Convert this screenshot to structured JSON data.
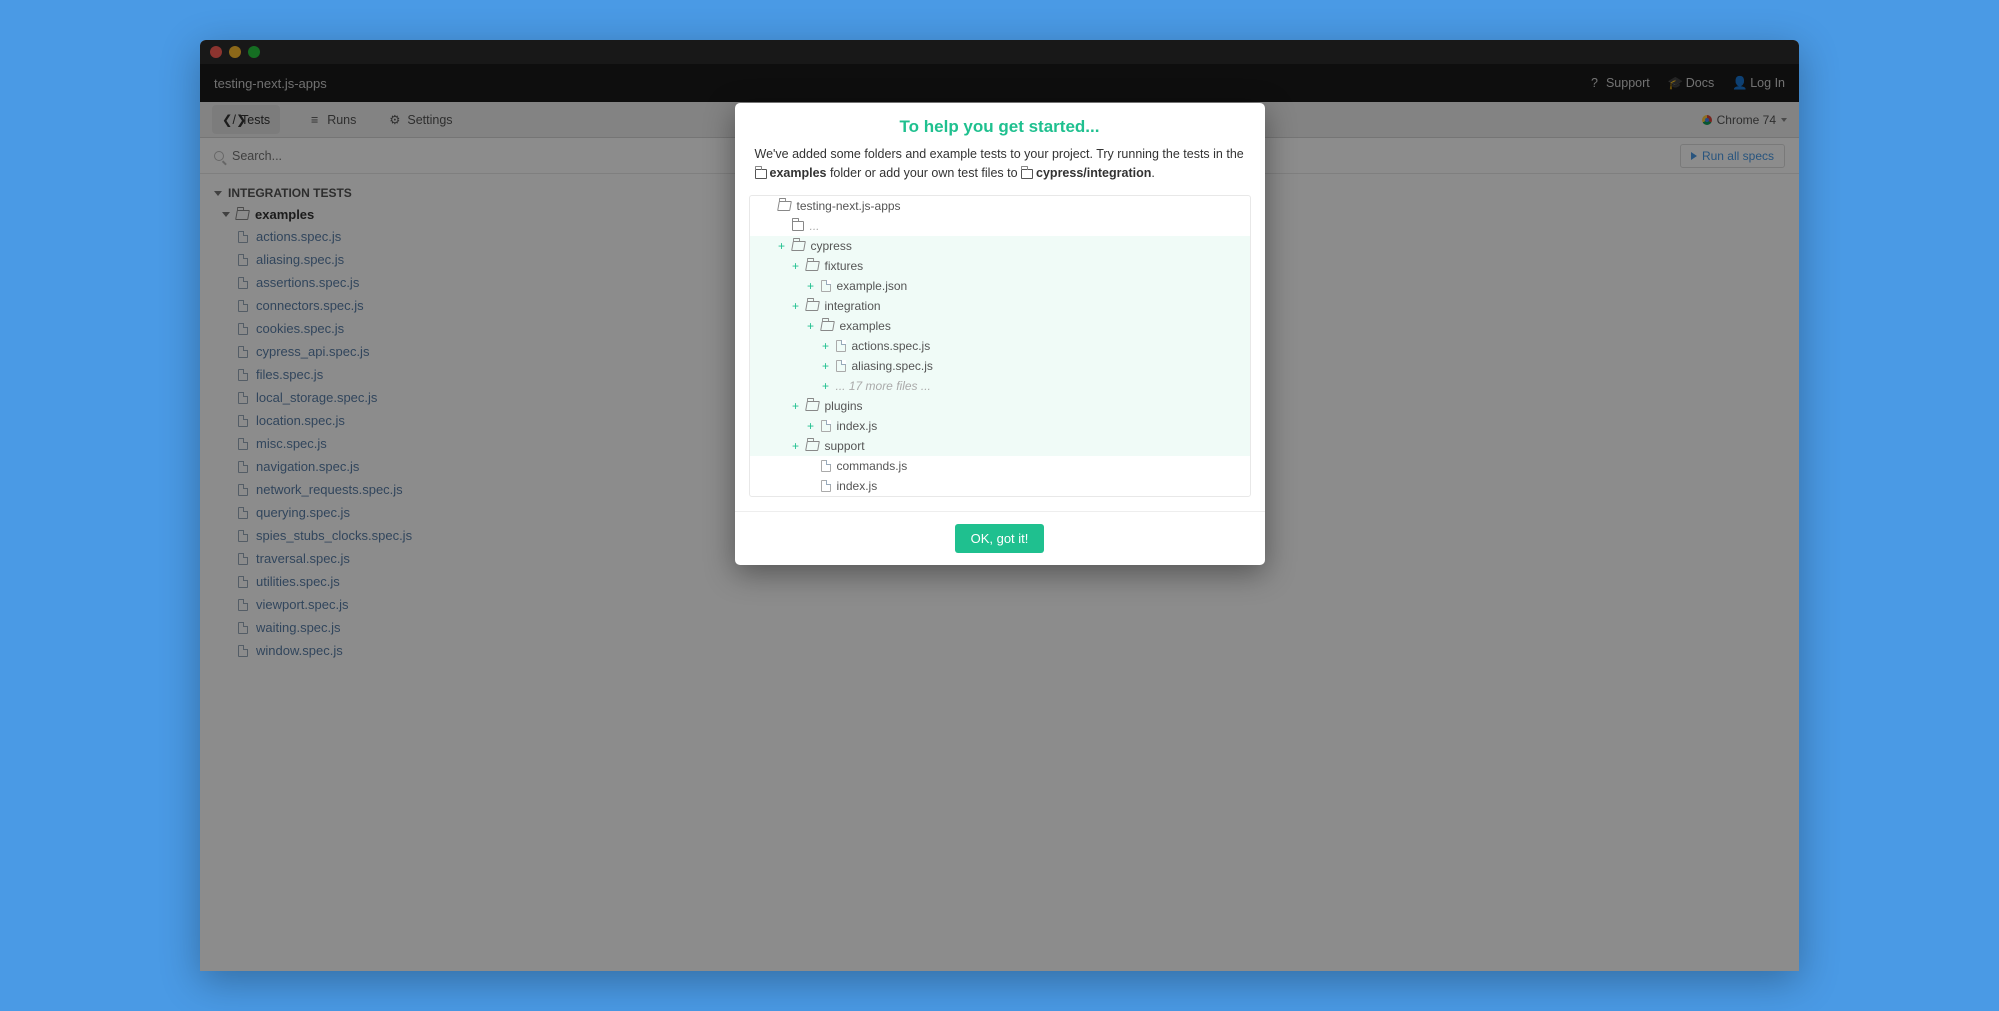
{
  "header": {
    "project_name": "testing-next.js-apps",
    "support": "Support",
    "docs": "Docs",
    "login": "Log In"
  },
  "tabs": {
    "tests": "Tests",
    "runs": "Runs",
    "settings": "Settings",
    "browser": "Chrome 74"
  },
  "search": {
    "placeholder": "Search...",
    "run_all": "Run all specs"
  },
  "sidebar": {
    "section": "INTEGRATION TESTS",
    "folder": "examples",
    "specs": [
      "actions.spec.js",
      "aliasing.spec.js",
      "assertions.spec.js",
      "connectors.spec.js",
      "cookies.spec.js",
      "cypress_api.spec.js",
      "files.spec.js",
      "local_storage.spec.js",
      "location.spec.js",
      "misc.spec.js",
      "navigation.spec.js",
      "network_requests.spec.js",
      "querying.spec.js",
      "spies_stubs_clocks.spec.js",
      "traversal.spec.js",
      "utilities.spec.js",
      "viewport.spec.js",
      "waiting.spec.js",
      "window.spec.js"
    ]
  },
  "modal": {
    "title": "To help you get started...",
    "text_pre": "We've added some folders and example tests to your project. Try running the tests in the ",
    "text_examples": "examples",
    "text_mid": " folder or add your own test files to ",
    "text_integration": "cypress/integration",
    "text_end": ".",
    "tree": {
      "root": "testing-next.js-apps",
      "ellipsis": "...",
      "cypress": "cypress",
      "fixtures": "fixtures",
      "example_json": "example.json",
      "integration": "integration",
      "examples": "examples",
      "actions": "actions.spec.js",
      "aliasing": "aliasing.spec.js",
      "more_files": "... 17 more files ...",
      "plugins": "plugins",
      "plugins_index": "index.js",
      "support": "support",
      "commands": "commands.js",
      "support_index": "index.js"
    },
    "ok": "OK, got it!"
  }
}
